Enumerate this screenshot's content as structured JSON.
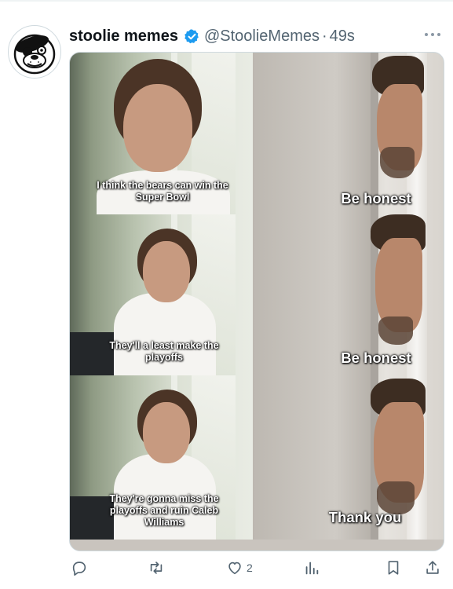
{
  "tweet": {
    "display_name": "stoolie memes",
    "handle": "@StoolieMemes",
    "separator": "·",
    "time": "49s",
    "verified_color": "#1d9bf0"
  },
  "media": {
    "panels": [
      {
        "left_caption": "I think the bears can win the Super Bowl",
        "right_caption": "Be honest"
      },
      {
        "left_caption": "They'll a least make the playoffs",
        "right_caption": "Be honest"
      },
      {
        "left_caption": "They're gonna miss the playoffs and ruin Caleb Williams",
        "right_caption": "Thank you"
      }
    ]
  },
  "actions": {
    "reply_icon": "reply-icon",
    "retweet_icon": "retweet-icon",
    "like_icon": "heart-icon",
    "like_count": "2",
    "views_icon": "analytics-icon",
    "bookmark_icon": "bookmark-icon",
    "share_icon": "share-icon"
  },
  "colors": {
    "text_primary": "#0f1419",
    "text_secondary": "#536471",
    "accent": "#1d9bf0"
  }
}
